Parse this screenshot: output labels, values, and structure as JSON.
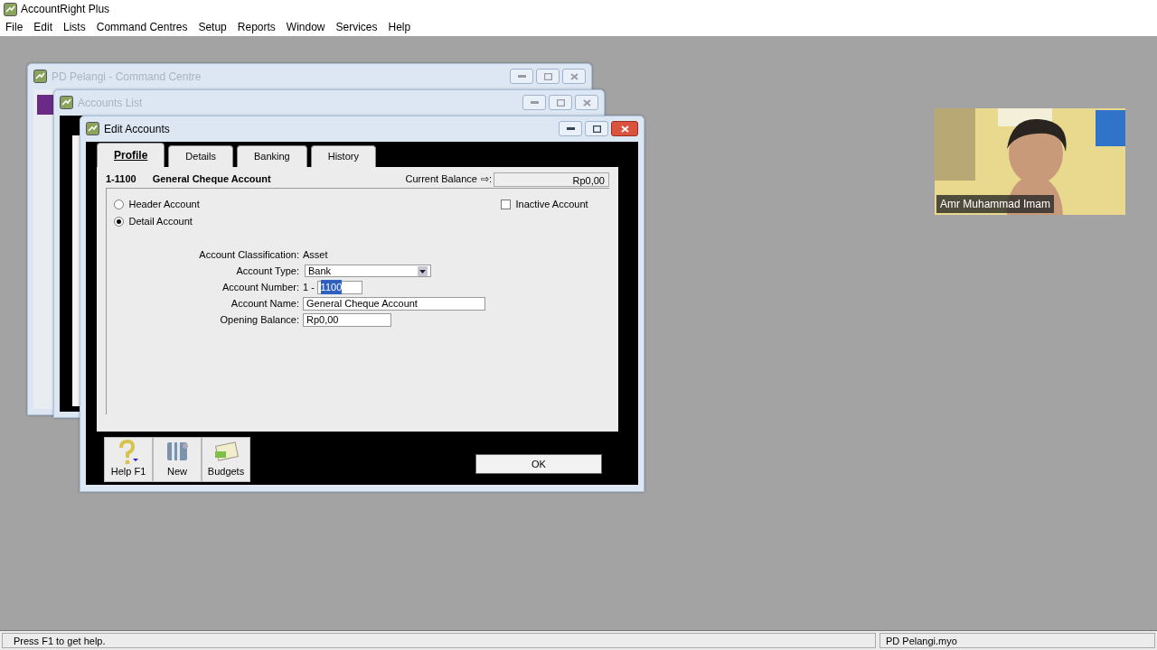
{
  "app": {
    "title": "AccountRight Plus"
  },
  "menu": [
    "File",
    "Edit",
    "Lists",
    "Command Centres",
    "Setup",
    "Reports",
    "Window",
    "Services",
    "Help"
  ],
  "background_windows": [
    {
      "title": "PD Pelangi - Command Centre"
    },
    {
      "title": "Accounts List"
    }
  ],
  "edit_window": {
    "title": "Edit Accounts",
    "tabs": [
      {
        "label": "Profile",
        "selected": true
      },
      {
        "label": "Details",
        "selected": false
      },
      {
        "label": "Banking",
        "selected": false
      },
      {
        "label": "History",
        "selected": false
      }
    ],
    "account_id": "1-1100",
    "account_name": "General Cheque Account",
    "balance_label": "Current Balance",
    "balance_arrow": "⇨:",
    "balance": "Rp0,00",
    "account_level": [
      {
        "label": "Header Account",
        "selected": false
      },
      {
        "label": "Detail Account",
        "selected": true
      }
    ],
    "inactive": {
      "label": "Inactive Account",
      "checked": false
    },
    "classification": {
      "label": "Account Classification:",
      "value": "Asset"
    },
    "account_type": {
      "label": "Account Type:",
      "value": "Bank"
    },
    "account_number": {
      "label": "Account Number:",
      "prefix": "1 -",
      "value": "1100",
      "text_selected": true
    },
    "account_name_field": {
      "label": "Account Name:",
      "value": "General Cheque Account"
    },
    "opening_balance": {
      "label": "Opening Balance:",
      "value": "Rp0,00"
    },
    "toolbar": [
      {
        "kind": "help",
        "label": "Help F1"
      },
      {
        "kind": "new",
        "label": "New"
      },
      {
        "kind": "budgets",
        "label": "Budgets"
      }
    ],
    "ok_button": "OK"
  },
  "video": {
    "kind": "picture",
    "caption": "Amr Muhammad Imam"
  },
  "status_bar": {
    "hint": "Press F1 to get help.",
    "file": "PD Pelangi.myo"
  }
}
